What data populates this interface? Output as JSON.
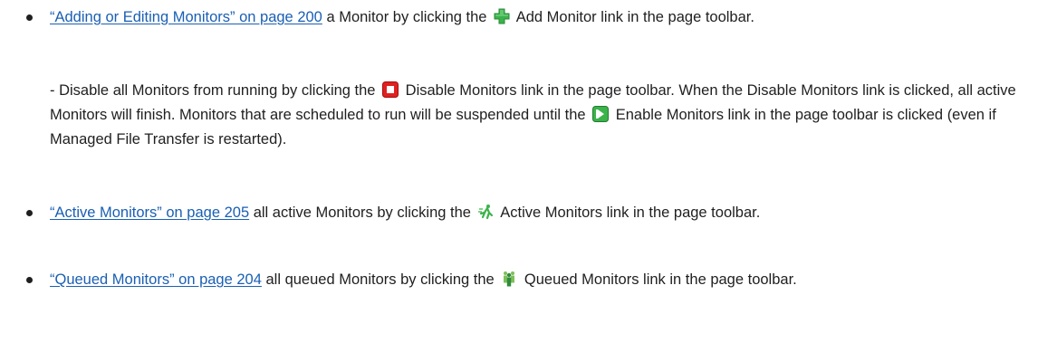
{
  "items": [
    {
      "link": "“Adding or Editing Monitors” on page 200",
      "text_before_icon": " a Monitor by clicking the ",
      "icon": "green-plus-icon",
      "text_after_icon": " Add Monitor link in the page toolbar."
    },
    {
      "prefix": "- Disable all Monitors from running by clicking the ",
      "icon1": "red-stop-icon",
      "mid": " Disable Monitors link in the page toolbar. When the Disable Monitors link is clicked, all active Monitors will finish. Monitors that are scheduled to run will be suspended until the ",
      "icon2": "green-play-icon",
      "suffix": " Enable Monitors link in the page toolbar is clicked (even if Managed File Transfer is restarted)."
    },
    {
      "link": "“Active Monitors” on page 205",
      "text_before_icon": " all active Monitors by clicking the ",
      "icon": "running-person-icon",
      "text_after_icon": " Active Monitors link in the page toolbar."
    },
    {
      "link": "“Queued Monitors” on page 204",
      "text_before_icon": " all queued Monitors by clicking the ",
      "icon": "queued-people-icon",
      "text_after_icon": " Queued Monitors link in the page toolbar."
    }
  ],
  "colors": {
    "link": "#1a5fb4",
    "text": "#1f1f1f",
    "green": "#3bb34a",
    "red": "#e02020"
  }
}
